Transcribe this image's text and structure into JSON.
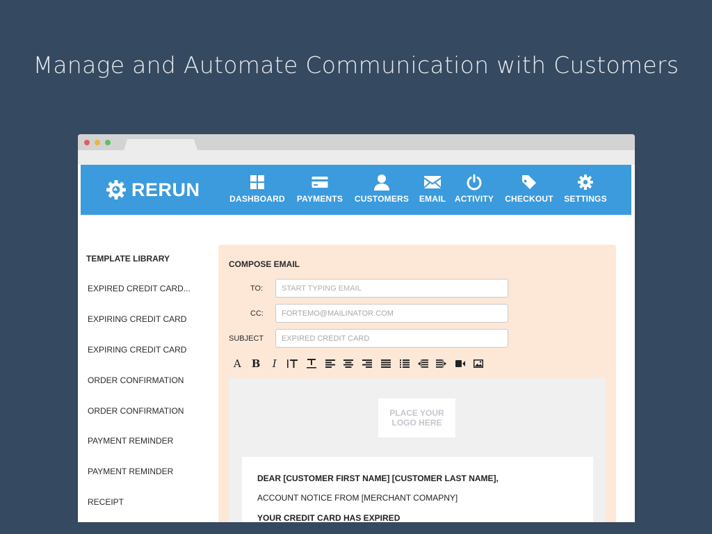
{
  "headline": "Manage and Automate Communication with Customers",
  "logo": {
    "text": "RERUN"
  },
  "nav": [
    {
      "label": "DASHBOARD",
      "icon": "grid-icon"
    },
    {
      "label": "PAYMENTS",
      "icon": "credit-card-icon"
    },
    {
      "label": "CUSTOMERS",
      "icon": "user-icon"
    },
    {
      "label": "EMAIL",
      "icon": "envelope-icon"
    },
    {
      "label": "ACTIVITY",
      "icon": "power-icon"
    },
    {
      "label": "CHECKOUT",
      "icon": "tag-icon"
    },
    {
      "label": "SETTINGS",
      "icon": "gear-icon"
    }
  ],
  "sidebar": {
    "title": "TEMPLATE LIBRARY",
    "items": [
      "EXPIRED CREDIT CARD...",
      "EXPIRING CREDIT CARD",
      "EXPIRING CREDIT CARD",
      "ORDER CONFIRMATION",
      "ORDER CONFIRMATION",
      "PAYMENT REMINDER",
      "PAYMENT REMINDER",
      "RECEIPT"
    ]
  },
  "compose": {
    "title": "COMPOSE EMAIL",
    "to_label": "TO:",
    "to_placeholder": "START TYPING EMAIL",
    "cc_label": "CC:",
    "cc_value": "FORTEMO@MAILINATOR.COM",
    "subject_label": "SUBJECT",
    "subject_value": "EXPIRED CREDIT CARD"
  },
  "toolbar": [
    "font-icon",
    "bold-icon",
    "italic-icon",
    "text-height-icon",
    "text-width-icon",
    "align-left-icon",
    "align-center-icon",
    "align-right-icon",
    "align-justify-icon",
    "list-icon",
    "indent-left-icon",
    "indent-right-icon",
    "video-icon",
    "image-icon"
  ],
  "editor": {
    "logo_placeholder": "PLACE YOUR LOGO HERE",
    "greeting": "DEAR [CUSTOMER FIRST NAME] [CUSTOMER LAST NAME],",
    "notice": "ACCOUNT NOTICE FROM [MERCHANT COMAPNY]",
    "heading": "YOUR CREDIT CARD HAS EXPIRED"
  },
  "colors": {
    "background": "#354960",
    "navbar": "#3b9bdc",
    "compose_panel": "#fde8d8"
  }
}
